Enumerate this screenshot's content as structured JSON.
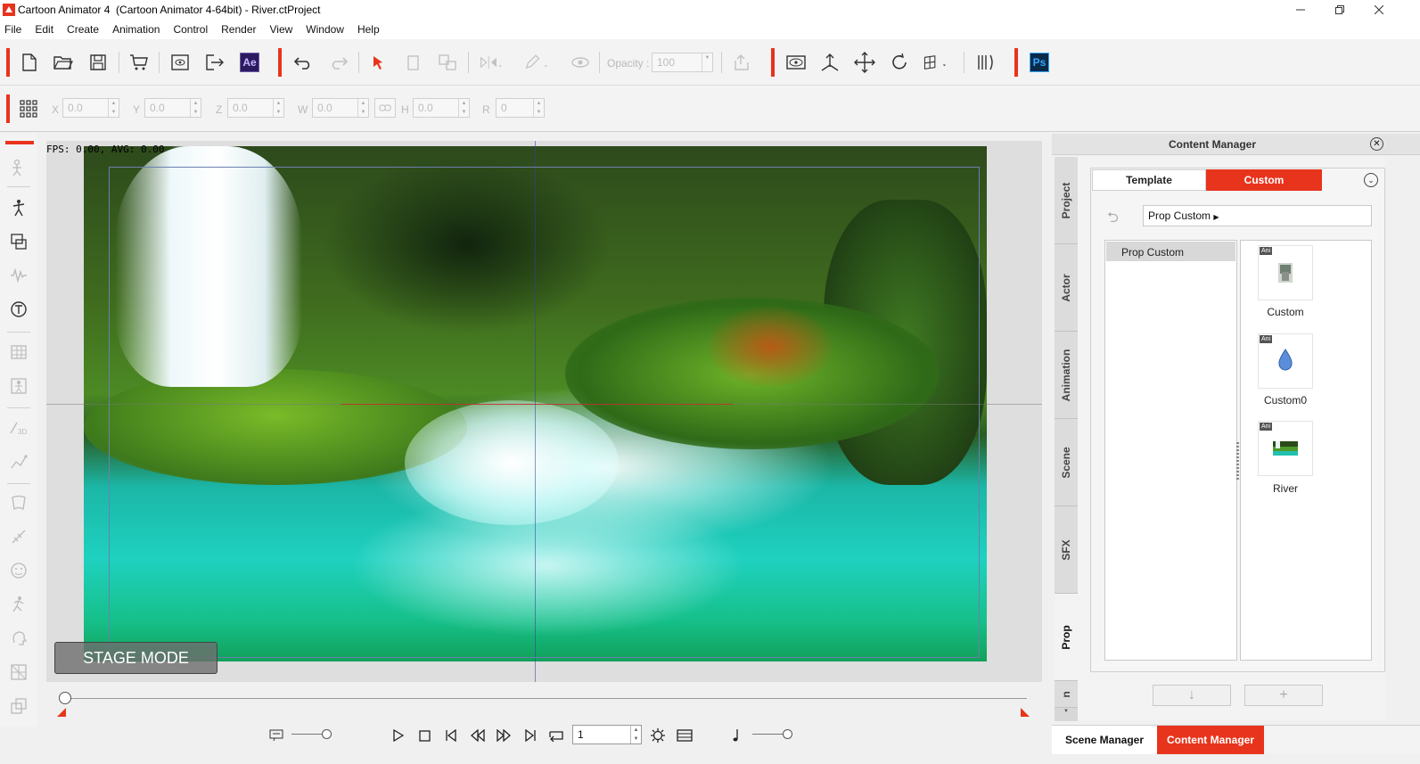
{
  "window": {
    "title": "Cartoon Animator 4  (Cartoon Animator 4-64bit) - River.ctProject"
  },
  "menu": [
    "File",
    "Edit",
    "Create",
    "Animation",
    "Control",
    "Render",
    "View",
    "Window",
    "Help"
  ],
  "toolbar": {
    "ae_label": "Ae",
    "ps_label": "Ps",
    "opacity_label": "Opacity :",
    "opacity_value": "100"
  },
  "transform": {
    "x_label": "X",
    "x_value": "0.0",
    "y_label": "Y",
    "y_value": "0.0",
    "z_label": "Z",
    "z_value": "0.0",
    "w_label": "W",
    "w_value": "0.0",
    "h_label": "H",
    "h_value": "0.0",
    "r_label": "R",
    "r_value": "0"
  },
  "stage": {
    "fps_text": "FPS: 0.00, AVG: 0.00",
    "mode_label": "STAGE MODE"
  },
  "playback": {
    "frame_value": "1"
  },
  "content_manager": {
    "title": "Content Manager",
    "side_tabs": [
      "Project",
      "Actor",
      "Animation",
      "Scene",
      "SFX",
      "Prop",
      "n"
    ],
    "active_side_tab": "Prop",
    "tabs": {
      "template": "Template",
      "custom": "Custom"
    },
    "active_tab": "Custom",
    "path": "Prop Custom",
    "tree": [
      "Prop Custom"
    ],
    "items": [
      {
        "label": "Custom",
        "badge": "Ani",
        "icon": "figure-thumbnail-icon"
      },
      {
        "label": "Custom0",
        "badge": "Ani",
        "icon": "water-drop-icon"
      },
      {
        "label": "River",
        "badge": "Ani",
        "icon": "landscape-thumbnail-icon"
      }
    ]
  },
  "bottom_tabs": {
    "scene": "Scene Manager",
    "content": "Content Manager"
  },
  "colors": {
    "accent": "#e8341c",
    "panel": "#f3f3f3",
    "stage_bg": "#dedede"
  }
}
